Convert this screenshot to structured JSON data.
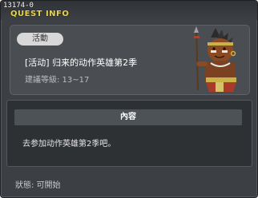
{
  "window": {
    "quest_id": "13174-0",
    "title": "QUEST INFO"
  },
  "quest": {
    "tag": "活動",
    "name": "[活动] 归来的动作英雄第2季",
    "level": "建議等級: 13~17"
  },
  "content": {
    "header": "內容",
    "text": "去参加动作英雄第2季吧。"
  },
  "status": "狀態: 可開始",
  "colors": {
    "title": "#e8d64a",
    "panel": "#4a4e53",
    "background": "#3c3f43"
  },
  "icons": {
    "npc": "tribal-warrior-npc"
  }
}
